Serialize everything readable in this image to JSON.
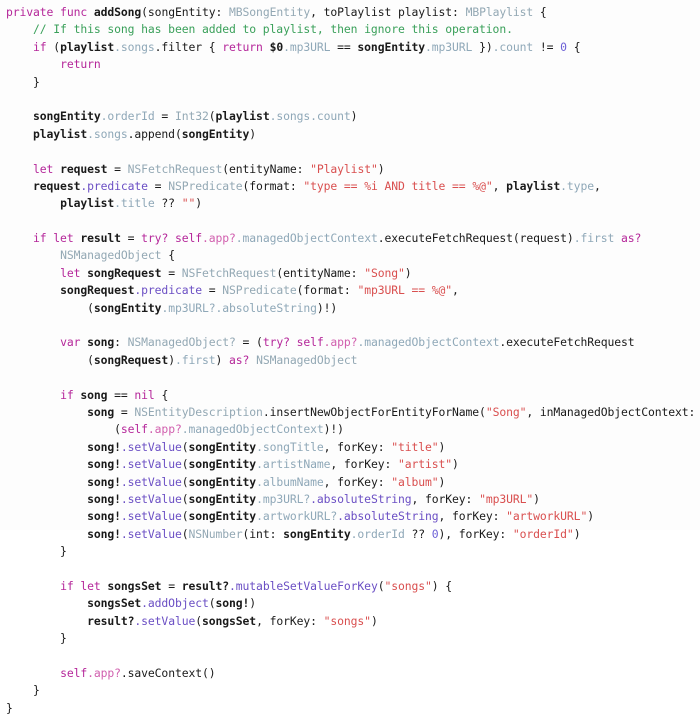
{
  "editor": {
    "language": "Swift",
    "background_color": "#fdfdfd",
    "colors": {
      "keyword": "#b5279a",
      "type": "#93a8b4",
      "property": "#8fa8b8",
      "method": "#6b4fc4",
      "string": "#d94f4f",
      "comment": "#3aa05a",
      "number": "#6b5fd6",
      "plain": "#1a1a1a"
    },
    "lines": [
      "private func addSong(songEntity: MBSongEntity, toPlaylist playlist: MBPlaylist) {",
      "    // If this song has been added to playlist, then ignore this operation.",
      "    if (playlist.songs.filter { return $0.mp3URL == songEntity.mp3URL }).count != 0 {",
      "        return",
      "    }",
      "",
      "    songEntity.orderId = Int32(playlist.songs.count)",
      "    playlist.songs.append(songEntity)",
      "",
      "    let request = NSFetchRequest(entityName: \"Playlist\")",
      "    request.predicate = NSPredicate(format: \"type == %i AND title == %@\", playlist.type,",
      "        playlist.title ?? \"\")",
      "",
      "    if let result = try? self.app?.managedObjectContext.executeFetchRequest(request).first as?",
      "        NSManagedObject {",
      "        let songRequest = NSFetchRequest(entityName: \"Song\")",
      "        songRequest.predicate = NSPredicate(format: \"mp3URL == %@\",",
      "            (songEntity.mp3URL?.absoluteString)!)",
      "",
      "        var song: NSManagedObject? = (try? self.app?.managedObjectContext.executeFetchRequest",
      "            (songRequest).first) as? NSManagedObject",
      "",
      "        if song == nil {",
      "            song = NSEntityDescription.insertNewObjectForEntityForName(\"Song\", inManagedObjectContext:",
      "                (self.app?.managedObjectContext)!)",
      "            song!.setValue(songEntity.songTitle, forKey: \"title\")",
      "            song!.setValue(songEntity.artistName, forKey: \"artist\")",
      "            song!.setValue(songEntity.albumName, forKey: \"album\")",
      "            song!.setValue(songEntity.mp3URL?.absoluteString, forKey: \"mp3URL\")",
      "            song!.setValue(songEntity.artworkURL?.absoluteString, forKey: \"artworkURL\")",
      "            song!.setValue(NSNumber(int: songEntity.orderId ?? 0), forKey: \"orderId\")",
      "        }",
      "",
      "        if let songsSet = result?.mutableSetValueForKey(\"songs\") {",
      "            songsSet.addObject(song!)",
      "            result?.setValue(songsSet, forKey: \"songs\")",
      "        }",
      "",
      "        self.app?.saveContext()",
      "    }",
      "}"
    ],
    "tokens": [
      [
        [
          "kw",
          "private func"
        ],
        [
          "pl",
          " "
        ],
        [
          "b",
          "addSong"
        ],
        [
          "pl",
          "(songEntity: "
        ],
        [
          "typ",
          "MBSongEntity"
        ],
        [
          "pl",
          ", toPlaylist playlist: "
        ],
        [
          "typ",
          "MBPlaylist"
        ],
        [
          "pl",
          " {"
        ]
      ],
      [
        [
          "pl",
          "    "
        ],
        [
          "cmt",
          "// If this song has been added to playlist, then ignore this operation."
        ]
      ],
      [
        [
          "pl",
          "    "
        ],
        [
          "kw",
          "if"
        ],
        [
          "pl",
          " ("
        ],
        [
          "b",
          "playlist"
        ],
        [
          "prop",
          ".songs"
        ],
        [
          "pl",
          ".filter { "
        ],
        [
          "kw",
          "return"
        ],
        [
          "pl",
          " "
        ],
        [
          "b",
          "$0"
        ],
        [
          "prop",
          ".mp3URL"
        ],
        [
          "pl",
          " == "
        ],
        [
          "b",
          "songEntity"
        ],
        [
          "prop",
          ".mp3URL"
        ],
        [
          "pl",
          " })"
        ],
        [
          "prop",
          ".count"
        ],
        [
          "pl",
          " != "
        ],
        [
          "num",
          "0"
        ],
        [
          "pl",
          " {"
        ]
      ],
      [
        [
          "pl",
          "        "
        ],
        [
          "kw",
          "return"
        ]
      ],
      [
        [
          "pl",
          "    }"
        ]
      ],
      [],
      [
        [
          "pl",
          "    "
        ],
        [
          "b",
          "songEntity"
        ],
        [
          "prop",
          ".orderId"
        ],
        [
          "pl",
          " = "
        ],
        [
          "typ",
          "Int32"
        ],
        [
          "pl",
          "("
        ],
        [
          "b",
          "playlist"
        ],
        [
          "prop",
          ".songs"
        ],
        [
          "prop",
          ".count"
        ],
        [
          "pl",
          ")"
        ]
      ],
      [
        [
          "pl",
          "    "
        ],
        [
          "b",
          "playlist"
        ],
        [
          "prop",
          ".songs"
        ],
        [
          "pl",
          ".append("
        ],
        [
          "b",
          "songEntity"
        ],
        [
          "pl",
          ")"
        ]
      ],
      [],
      [
        [
          "pl",
          "    "
        ],
        [
          "kw",
          "let"
        ],
        [
          "pl",
          " "
        ],
        [
          "b",
          "request"
        ],
        [
          "pl",
          " = "
        ],
        [
          "typ",
          "NSFetchRequest"
        ],
        [
          "pl",
          "(entityName: "
        ],
        [
          "str",
          "\"Playlist\""
        ],
        [
          "pl",
          ")"
        ]
      ],
      [
        [
          "pl",
          "    "
        ],
        [
          "b",
          "request"
        ],
        [
          "meth",
          ".predicate"
        ],
        [
          "pl",
          " = "
        ],
        [
          "typ",
          "NSPredicate"
        ],
        [
          "pl",
          "(format: "
        ],
        [
          "str",
          "\"type == %i AND title == %@\""
        ],
        [
          "pl",
          ", "
        ],
        [
          "b",
          "playlist"
        ],
        [
          "prop",
          ".type"
        ],
        [
          "pl",
          ","
        ]
      ],
      [
        [
          "pl",
          "        "
        ],
        [
          "b",
          "playlist"
        ],
        [
          "prop",
          ".title"
        ],
        [
          "pl",
          " ?? "
        ],
        [
          "str",
          "\"\""
        ],
        [
          "pl",
          ")"
        ]
      ],
      [],
      [
        [
          "pl",
          "    "
        ],
        [
          "kw",
          "if let"
        ],
        [
          "pl",
          " "
        ],
        [
          "b",
          "result"
        ],
        [
          "pl",
          " = "
        ],
        [
          "kw",
          "try?"
        ],
        [
          "pl",
          " "
        ],
        [
          "kw",
          "self"
        ],
        [
          "pink",
          ".app?"
        ],
        [
          "prop",
          ".managedObjectContext"
        ],
        [
          "pl",
          ".executeFetchRequest(request)"
        ],
        [
          "prop",
          ".first"
        ],
        [
          "pl",
          " "
        ],
        [
          "kw",
          "as?"
        ]
      ],
      [
        [
          "pl",
          "        "
        ],
        [
          "typ",
          "NSManagedObject"
        ],
        [
          "pl",
          " {"
        ]
      ],
      [
        [
          "pl",
          "        "
        ],
        [
          "kw",
          "let"
        ],
        [
          "pl",
          " "
        ],
        [
          "b",
          "songRequest"
        ],
        [
          "pl",
          " = "
        ],
        [
          "typ",
          "NSFetchRequest"
        ],
        [
          "pl",
          "(entityName: "
        ],
        [
          "str",
          "\"Song\""
        ],
        [
          "pl",
          ")"
        ]
      ],
      [
        [
          "pl",
          "        "
        ],
        [
          "b",
          "songRequest"
        ],
        [
          "meth",
          ".predicate"
        ],
        [
          "pl",
          " = "
        ],
        [
          "typ",
          "NSPredicate"
        ],
        [
          "pl",
          "(format: "
        ],
        [
          "str",
          "\"mp3URL == %@\""
        ],
        [
          "pl",
          ","
        ]
      ],
      [
        [
          "pl",
          "            ("
        ],
        [
          "b",
          "songEntity"
        ],
        [
          "prop",
          ".mp3URL?"
        ],
        [
          "prop",
          ".absoluteString"
        ],
        [
          "pl",
          ")!)"
        ]
      ],
      [],
      [
        [
          "pl",
          "        "
        ],
        [
          "kw",
          "var"
        ],
        [
          "pl",
          " "
        ],
        [
          "b",
          "song"
        ],
        [
          "pl",
          ": "
        ],
        [
          "typ",
          "NSManagedObject?"
        ],
        [
          "pl",
          " = ("
        ],
        [
          "kw",
          "try?"
        ],
        [
          "pl",
          " "
        ],
        [
          "kw",
          "self"
        ],
        [
          "pink",
          ".app?"
        ],
        [
          "prop",
          ".managedObjectContext"
        ],
        [
          "pl",
          ".executeFetchRequest"
        ]
      ],
      [
        [
          "pl",
          "            ("
        ],
        [
          "b",
          "songRequest"
        ],
        [
          "pl",
          ")"
        ],
        [
          "prop",
          ".first"
        ],
        [
          "pl",
          ") "
        ],
        [
          "kw",
          "as?"
        ],
        [
          "pl",
          " "
        ],
        [
          "typ",
          "NSManagedObject"
        ]
      ],
      [],
      [
        [
          "pl",
          "        "
        ],
        [
          "kw",
          "if"
        ],
        [
          "pl",
          " "
        ],
        [
          "b",
          "song"
        ],
        [
          "pl",
          " == "
        ],
        [
          "kw",
          "nil"
        ],
        [
          "pl",
          " {"
        ]
      ],
      [
        [
          "pl",
          "            "
        ],
        [
          "b",
          "song"
        ],
        [
          "pl",
          " = "
        ],
        [
          "typ",
          "NSEntityDescription"
        ],
        [
          "pl",
          ".insertNewObjectForEntityForName("
        ],
        [
          "str",
          "\"Song\""
        ],
        [
          "pl",
          ", inManagedObjectContext:"
        ]
      ],
      [
        [
          "pl",
          "                ("
        ],
        [
          "kw",
          "self"
        ],
        [
          "pink",
          ".app?"
        ],
        [
          "prop",
          ".managedObjectContext"
        ],
        [
          "pl",
          ")!)"
        ]
      ],
      [
        [
          "pl",
          "            "
        ],
        [
          "b",
          "song!"
        ],
        [
          "meth",
          ".setValue"
        ],
        [
          "pl",
          "("
        ],
        [
          "b",
          "songEntity"
        ],
        [
          "prop",
          ".songTitle"
        ],
        [
          "pl",
          ", forKey: "
        ],
        [
          "str",
          "\"title\""
        ],
        [
          "pl",
          ")"
        ]
      ],
      [
        [
          "pl",
          "            "
        ],
        [
          "b",
          "song!"
        ],
        [
          "meth",
          ".setValue"
        ],
        [
          "pl",
          "("
        ],
        [
          "b",
          "songEntity"
        ],
        [
          "prop",
          ".artistName"
        ],
        [
          "pl",
          ", forKey: "
        ],
        [
          "str",
          "\"artist\""
        ],
        [
          "pl",
          ")"
        ]
      ],
      [
        [
          "pl",
          "            "
        ],
        [
          "b",
          "song!"
        ],
        [
          "meth",
          ".setValue"
        ],
        [
          "pl",
          "("
        ],
        [
          "b",
          "songEntity"
        ],
        [
          "prop",
          ".albumName"
        ],
        [
          "pl",
          ", forKey: "
        ],
        [
          "str",
          "\"album\""
        ],
        [
          "pl",
          ")"
        ]
      ],
      [
        [
          "pl",
          "            "
        ],
        [
          "b",
          "song!"
        ],
        [
          "meth",
          ".setValue"
        ],
        [
          "pl",
          "("
        ],
        [
          "b",
          "songEntity"
        ],
        [
          "prop",
          ".mp3URL?"
        ],
        [
          "meth",
          ".absoluteString"
        ],
        [
          "pl",
          ", forKey: "
        ],
        [
          "str",
          "\"mp3URL\""
        ],
        [
          "pl",
          ")"
        ]
      ],
      [
        [
          "pl",
          "            "
        ],
        [
          "b",
          "song!"
        ],
        [
          "meth",
          ".setValue"
        ],
        [
          "pl",
          "("
        ],
        [
          "b",
          "songEntity"
        ],
        [
          "prop",
          ".artworkURL?"
        ],
        [
          "meth",
          ".absoluteString"
        ],
        [
          "pl",
          ", forKey: "
        ],
        [
          "str",
          "\"artworkURL\""
        ],
        [
          "pl",
          ")"
        ]
      ],
      [
        [
          "pl",
          "            "
        ],
        [
          "b",
          "song!"
        ],
        [
          "meth",
          ".setValue"
        ],
        [
          "pl",
          "("
        ],
        [
          "typ",
          "NSNumber"
        ],
        [
          "pl",
          "(int: "
        ],
        [
          "b",
          "songEntity"
        ],
        [
          "prop",
          ".orderId"
        ],
        [
          "pl",
          " ?? "
        ],
        [
          "num",
          "0"
        ],
        [
          "pl",
          "), forKey: "
        ],
        [
          "str",
          "\"orderId\""
        ],
        [
          "pl",
          ")"
        ]
      ],
      [
        [
          "pl",
          "        }"
        ]
      ],
      [],
      [
        [
          "pl",
          "        "
        ],
        [
          "kw",
          "if let"
        ],
        [
          "pl",
          " "
        ],
        [
          "b",
          "songsSet"
        ],
        [
          "pl",
          " = "
        ],
        [
          "b",
          "result?"
        ],
        [
          "meth",
          ".mutableSetValueForKey"
        ],
        [
          "pl",
          "("
        ],
        [
          "str",
          "\"songs\""
        ],
        [
          "pl",
          ") {"
        ]
      ],
      [
        [
          "pl",
          "            "
        ],
        [
          "b",
          "songsSet"
        ],
        [
          "meth",
          ".addObject"
        ],
        [
          "pl",
          "("
        ],
        [
          "b",
          "song!"
        ],
        [
          "pl",
          ")"
        ]
      ],
      [
        [
          "pl",
          "            "
        ],
        [
          "b",
          "result?"
        ],
        [
          "meth",
          ".setValue"
        ],
        [
          "pl",
          "("
        ],
        [
          "b",
          "songsSet"
        ],
        [
          "pl",
          ", forKey: "
        ],
        [
          "str",
          "\"songs\""
        ],
        [
          "pl",
          ")"
        ]
      ],
      [
        [
          "pl",
          "        }"
        ]
      ],
      [],
      [
        [
          "pl",
          "        "
        ],
        [
          "kw",
          "self"
        ],
        [
          "pink",
          ".app?"
        ],
        [
          "pl",
          ".saveContext()"
        ]
      ],
      [
        [
          "pl",
          "    }"
        ]
      ],
      [
        [
          "pl",
          "}"
        ]
      ]
    ]
  }
}
